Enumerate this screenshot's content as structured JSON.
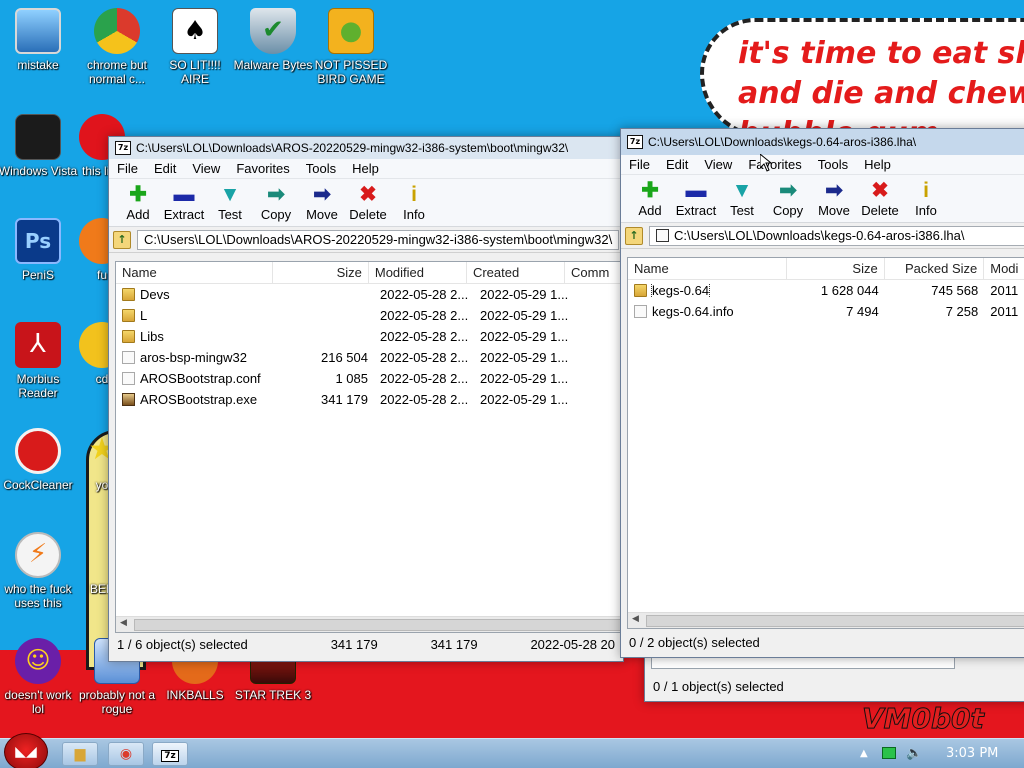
{
  "desktop": {
    "bubble_lines": [
      "it's time to eat shit",
      "and die and chew",
      "bubble gum"
    ],
    "watermark": "VM0b0t",
    "icons": [
      {
        "label": "mistake",
        "icon": "monitor-icon"
      },
      {
        "label": "chrome but normal c...",
        "icon": "chrome-icon"
      },
      {
        "label": "SO LIT!!!! AIRE",
        "icon": "cards-icon"
      },
      {
        "label": "Malware Bytes",
        "icon": "shield-icon"
      },
      {
        "label": "NOT PISSED BIRD GAME",
        "icon": "pig-icon"
      },
      {
        "label": "Windows Vista",
        "icon": "vista-icon"
      },
      {
        "label": "this like",
        "icon": "opera-icon"
      },
      {
        "label": "PeniS",
        "icon": "photoshop-icon"
      },
      {
        "label": "fu",
        "icon": "firefox-icon"
      },
      {
        "label": "Morbius Reader",
        "icon": "acrobat-icon"
      },
      {
        "label": "cd",
        "icon": "disc-icon"
      },
      {
        "label": "CockCleaner",
        "icon": "ccleaner-icon"
      },
      {
        "label": "yo",
        "icon": "star-icon"
      },
      {
        "label": "who the fuck uses this",
        "icon": "winamp-icon"
      },
      {
        "label": "BEE",
        "icon": "bee-icon"
      },
      {
        "label": "doesn't work lol",
        "icon": "yahoo-icon"
      },
      {
        "label": "probably not a rogue",
        "icon": "antivirus-icon"
      },
      {
        "label": "INKBALLS",
        "icon": "inkball-icon"
      },
      {
        "label": "STAR TREK 3",
        "icon": "startrek-icon"
      }
    ]
  },
  "window_left": {
    "title": "C:\\Users\\LOL\\Downloads\\AROS-20220529-mingw32-i386-system\\boot\\mingw32\\",
    "menu": [
      "File",
      "Edit",
      "View",
      "Favorites",
      "Tools",
      "Help"
    ],
    "toolbar": [
      {
        "label": "Add",
        "icon": "plus-icon",
        "glyph": "✚",
        "color": "#1aa61a"
      },
      {
        "label": "Extract",
        "icon": "minus-icon",
        "glyph": "▬",
        "color": "#1c2aa8"
      },
      {
        "label": "Test",
        "icon": "test-icon",
        "glyph": "▼",
        "color": "#19a3a6"
      },
      {
        "label": "Copy",
        "icon": "copy-arrow-icon",
        "glyph": "➡",
        "color": "#1a8a7a"
      },
      {
        "label": "Move",
        "icon": "move-arrow-icon",
        "glyph": "➡",
        "color": "#1b2a8c"
      },
      {
        "label": "Delete",
        "icon": "delete-icon",
        "glyph": "✖",
        "color": "#d81b1b"
      },
      {
        "label": "Info",
        "icon": "info-icon",
        "glyph": "i",
        "color": "#c9a200"
      }
    ],
    "address": "C:\\Users\\LOL\\Downloads\\AROS-20220529-mingw32-i386-system\\boot\\mingw32\\",
    "columns": [
      "Name",
      "Size",
      "Modified",
      "Created",
      "Comm"
    ],
    "rows": [
      {
        "name": "Devs",
        "type": "folder",
        "size": "",
        "modified": "2022-05-28 2...",
        "created": "2022-05-29 1..."
      },
      {
        "name": "L",
        "type": "folder",
        "size": "",
        "modified": "2022-05-28 2...",
        "created": "2022-05-29 1..."
      },
      {
        "name": "Libs",
        "type": "folder",
        "size": "",
        "modified": "2022-05-28 2...",
        "created": "2022-05-29 1..."
      },
      {
        "name": "aros-bsp-mingw32",
        "type": "file",
        "size": "216 504",
        "modified": "2022-05-28 2...",
        "created": "2022-05-29 1..."
      },
      {
        "name": "AROSBootstrap.conf",
        "type": "file",
        "size": "1 085",
        "modified": "2022-05-28 2...",
        "created": "2022-05-29 1..."
      },
      {
        "name": "AROSBootstrap.exe",
        "type": "exe",
        "size": "341 179",
        "modified": "2022-05-28 2...",
        "created": "2022-05-29 1..."
      }
    ],
    "status": {
      "selected": "1 / 6 object(s) selected",
      "size": "341 179",
      "packed": "341 179",
      "date": "2022-05-28 20"
    }
  },
  "window_right": {
    "title": "C:\\Users\\LOL\\Downloads\\kegs-0.64-aros-i386.lha\\",
    "menu": [
      "File",
      "Edit",
      "View",
      "Favorites",
      "Tools",
      "Help"
    ],
    "toolbar": [
      {
        "label": "Add",
        "icon": "plus-icon",
        "glyph": "✚",
        "color": "#1aa61a"
      },
      {
        "label": "Extract",
        "icon": "minus-icon",
        "glyph": "▬",
        "color": "#1c2aa8"
      },
      {
        "label": "Test",
        "icon": "test-icon",
        "glyph": "▼",
        "color": "#19a3a6"
      },
      {
        "label": "Copy",
        "icon": "copy-arrow-icon",
        "glyph": "➡",
        "color": "#1a8a7a"
      },
      {
        "label": "Move",
        "icon": "move-arrow-icon",
        "glyph": "➡",
        "color": "#1b2a8c"
      },
      {
        "label": "Delete",
        "icon": "delete-icon",
        "glyph": "✖",
        "color": "#d81b1b"
      },
      {
        "label": "Info",
        "icon": "info-icon",
        "glyph": "i",
        "color": "#c9a200"
      }
    ],
    "address": "C:\\Users\\LOL\\Downloads\\kegs-0.64-aros-i386.lha\\",
    "columns": [
      "Name",
      "Size",
      "Packed Size",
      "Modi"
    ],
    "rows": [
      {
        "name": "kegs-0.64",
        "type": "folder",
        "size": "1 628 044",
        "packed": "745 568",
        "modified": "2011"
      },
      {
        "name": "kegs-0.64.info",
        "type": "file",
        "size": "7 494",
        "packed": "7 258",
        "modified": "2011"
      }
    ],
    "status": {
      "selected": "0 / 2 object(s) selected"
    }
  },
  "window_behind": {
    "status": "0 / 1 object(s) selected"
  },
  "taskbar": {
    "time": "3:03 PM",
    "items": [
      {
        "icon": "start-angry-bird-icon"
      },
      {
        "icon": "explorer-folder-icon"
      },
      {
        "icon": "chrome-icon"
      },
      {
        "icon": "7zip-icon"
      }
    ]
  }
}
